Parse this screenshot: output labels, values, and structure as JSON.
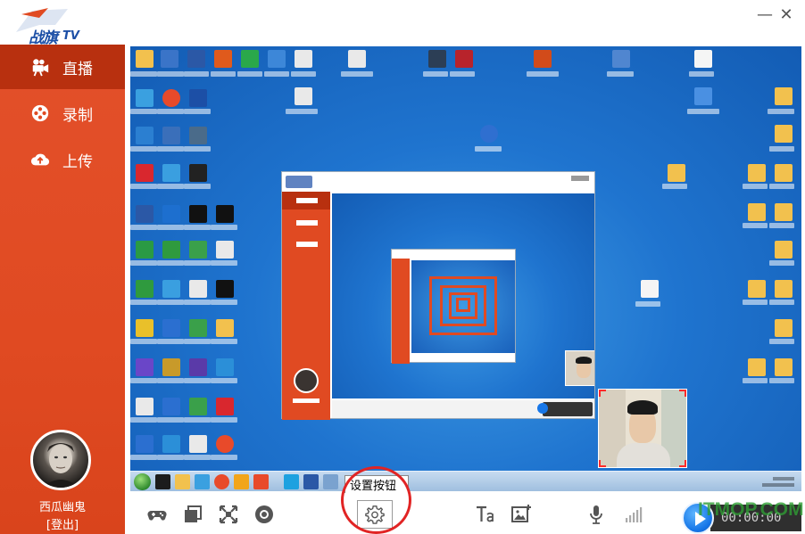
{
  "app": {
    "logo_text": "战旗",
    "logo_tv": "TV"
  },
  "window": {
    "minimize_glyph": "—",
    "close_glyph": "✕"
  },
  "sidebar": {
    "items": [
      {
        "label": "直播",
        "icon": "video-camera-icon",
        "active": true
      },
      {
        "label": "录制",
        "icon": "film-reel-icon",
        "active": false
      },
      {
        "label": "上传",
        "icon": "cloud-upload-icon",
        "active": false
      }
    ],
    "user": {
      "name": "西瓜幽鬼",
      "logout": "[登出]"
    }
  },
  "toolbar": {
    "tools": [
      {
        "name": "gamepad-icon"
      },
      {
        "name": "window-capture-icon"
      },
      {
        "name": "fullscreen-capture-icon"
      },
      {
        "name": "camera-source-icon"
      },
      {
        "name": "settings-gear-icon"
      },
      {
        "name": "text-overlay-icon"
      },
      {
        "name": "image-overlay-icon"
      },
      {
        "name": "microphone-icon"
      },
      {
        "name": "volume-level-icon"
      }
    ],
    "settings_tooltip": "设置按钮",
    "timer": "00:00:00",
    "play_icon": "play-icon"
  },
  "watermark": "ITMOP.COM",
  "colors": {
    "sidebar": "#e04a22",
    "sidebar_active": "#b8300f",
    "highlight_circle": "#e12424",
    "desktop": "#1f74cf"
  }
}
